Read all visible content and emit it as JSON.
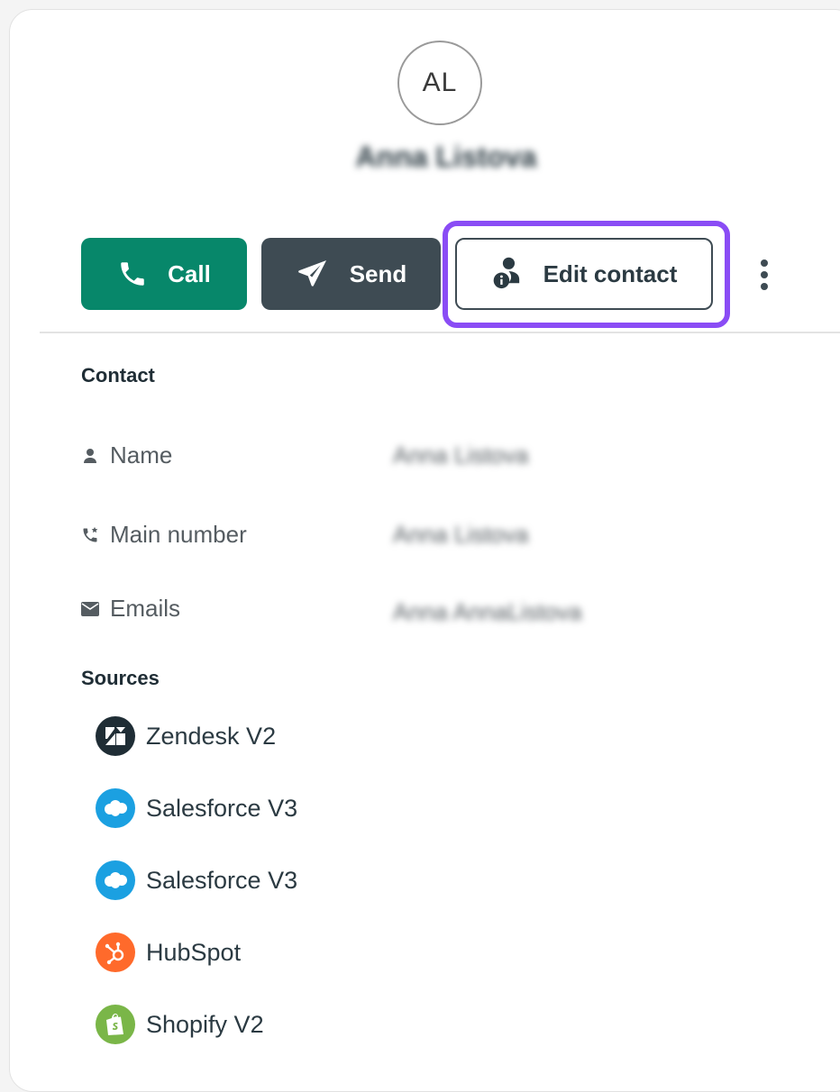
{
  "contact": {
    "initials": "AL",
    "name": "Anna Listova"
  },
  "actions": {
    "call_label": "Call",
    "send_label": "Send",
    "edit_label": "Edit contact",
    "highlight_color": "#8a4cf5"
  },
  "sections": {
    "contact_title": "Contact",
    "sources_title": "Sources"
  },
  "fields": [
    {
      "label": "Name",
      "value": "Anna Listova",
      "icon": "person-icon"
    },
    {
      "label": "Main number",
      "value": "Anna Listova",
      "icon": "phone-star-icon"
    },
    {
      "label": "Emails",
      "value": "Anna AnnaListova",
      "icon": "mail-icon"
    }
  ],
  "sources": [
    {
      "name": "Zendesk V2",
      "icon": "zendesk-icon",
      "color": "#1f2d35"
    },
    {
      "name": "Salesforce V3",
      "icon": "salesforce-icon",
      "color": "#1ba0e1"
    },
    {
      "name": "Salesforce V3",
      "icon": "salesforce-icon",
      "color": "#1ba0e1"
    },
    {
      "name": "HubSpot",
      "icon": "hubspot-icon",
      "color": "#ff6a2b"
    },
    {
      "name": "Shopify V2",
      "icon": "shopify-icon",
      "color": "#7ab648"
    }
  ],
  "colors": {
    "call_bg": "#07876a",
    "send_bg": "#3e4b53",
    "text": "#2b3a42"
  }
}
